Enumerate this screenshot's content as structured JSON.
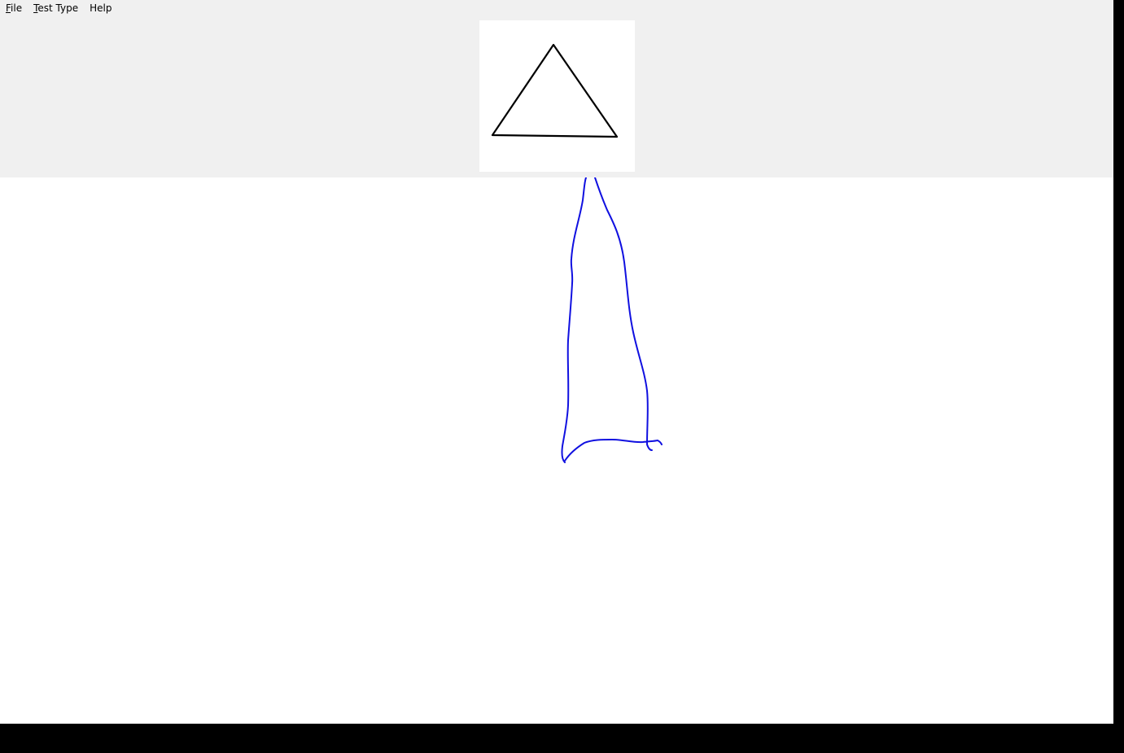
{
  "menubar": {
    "items": [
      {
        "mnemonic": "F",
        "rest": "ile"
      },
      {
        "mnemonic": "T",
        "rest": "est Type"
      },
      {
        "mnemonic": "",
        "rest": "Help"
      }
    ]
  },
  "reference": {
    "shape": "triangle",
    "stroke_color": "#000000"
  },
  "canvas": {
    "ink_color": "#1010e0",
    "background": "#ffffff"
  },
  "colors": {
    "panel_bg": "#f0f0f0",
    "outer_bg": "#000000"
  }
}
